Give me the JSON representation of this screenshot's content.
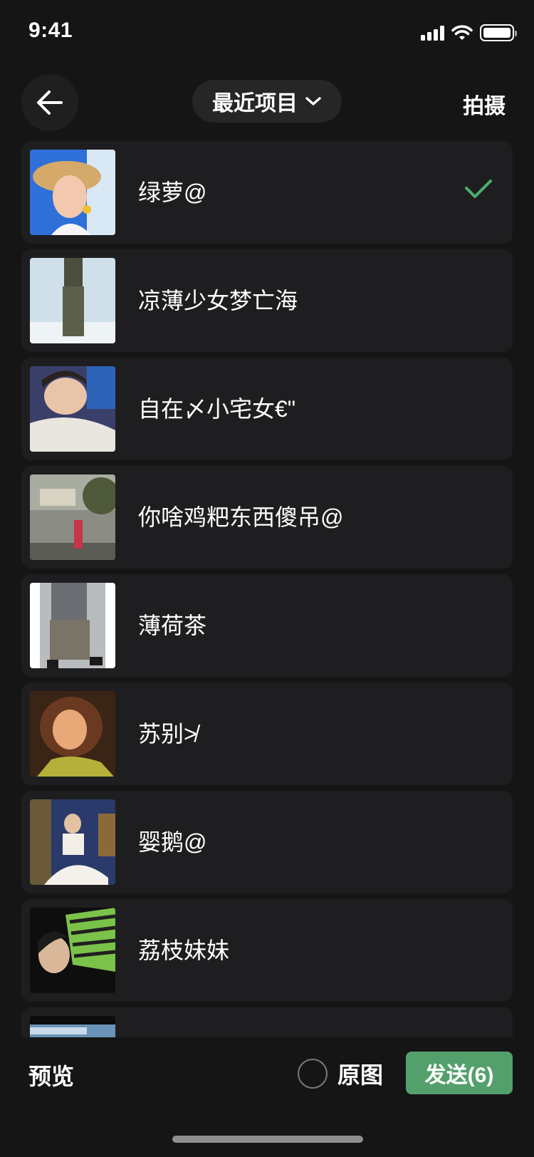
{
  "status_bar": {
    "time": "9:41",
    "icons": [
      "signal-icon",
      "wifi-icon",
      "battery-icon"
    ]
  },
  "nav": {
    "back_icon": "arrow-left-icon",
    "album_picker_label": "最近项目",
    "album_picker_icon": "chevron-down-icon",
    "capture_label": "拍摄"
  },
  "albums": [
    {
      "name": "绿萝@",
      "selected": true
    },
    {
      "name": "凉薄少女梦亡海",
      "selected": false
    },
    {
      "name": "自在〆小宅女€\"",
      "selected": false
    },
    {
      "name": "你啥鸡粑东西傻吊@",
      "selected": false
    },
    {
      "name": "薄荷茶",
      "selected": false
    },
    {
      "name": "苏别≯",
      "selected": false
    },
    {
      "name": "婴鹅@",
      "selected": false
    },
    {
      "name": "荔枝妹妹",
      "selected": false
    },
    {
      "name": "",
      "selected": false
    }
  ],
  "bottom_bar": {
    "preview_label": "预览",
    "original_label": "原图",
    "send_label": "发送(6)"
  },
  "colors": {
    "background": "#151515",
    "item_background": "#1e1e20",
    "accent_green": "#54a06c",
    "check_green": "#4caf6e"
  }
}
